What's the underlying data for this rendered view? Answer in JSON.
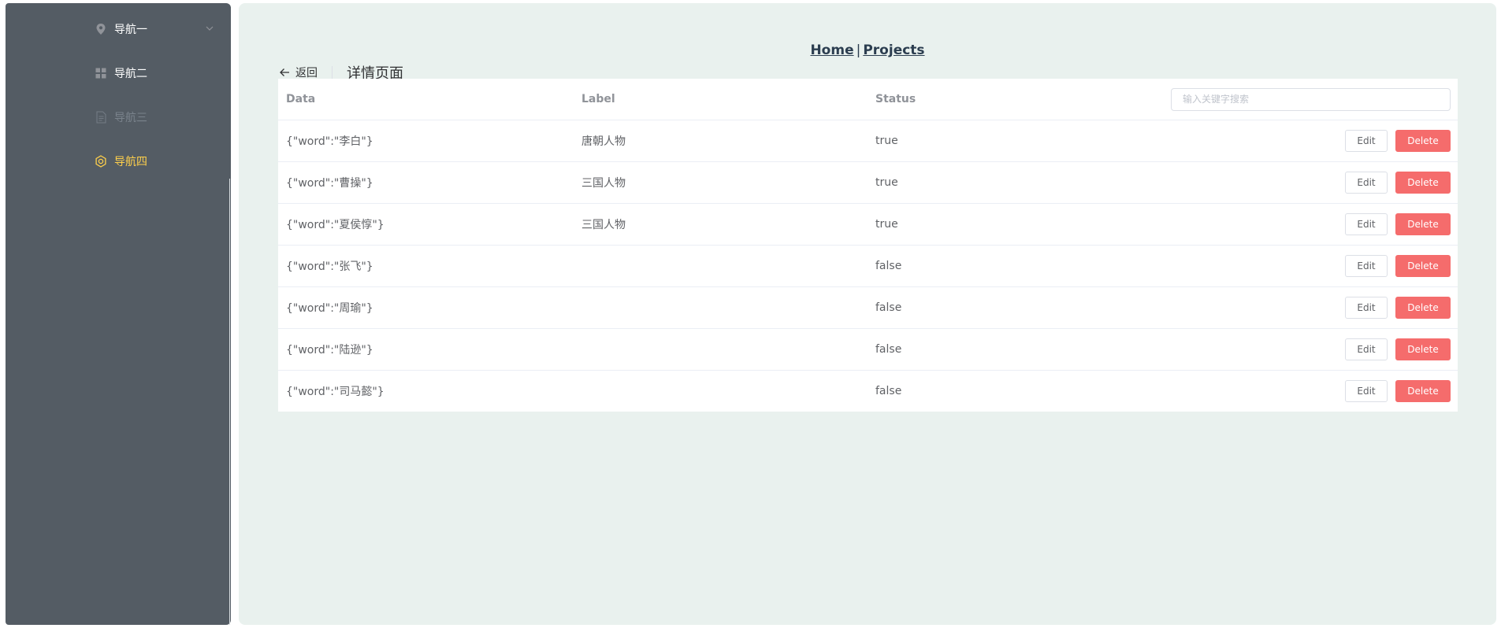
{
  "sidebar": {
    "items": [
      {
        "label": "导航一",
        "icon": "location-icon",
        "state": "normal",
        "has_submenu": true
      },
      {
        "label": "导航二",
        "icon": "menu-grid-icon",
        "state": "normal"
      },
      {
        "label": "导航三",
        "icon": "document-icon",
        "state": "disabled"
      },
      {
        "label": "导航四",
        "icon": "setting-icon",
        "state": "active"
      }
    ],
    "background": "#545c64",
    "active_color": "#ffd04b"
  },
  "top_links": {
    "home": "Home",
    "separator": "|",
    "projects": "Projects"
  },
  "page_header": {
    "back_label": "返回",
    "title": "详情页面"
  },
  "table": {
    "headers": {
      "data": "Data",
      "label": "Label",
      "status": "Status"
    },
    "search_placeholder": "输入关键字搜索",
    "search_value": "",
    "edit_label": "Edit",
    "delete_label": "Delete",
    "rows": [
      {
        "data": "{\"word\":\"李白\"}",
        "label": "唐朝人物",
        "status": "true"
      },
      {
        "data": "{\"word\":\"曹操\"}",
        "label": "三国人物",
        "status": "true"
      },
      {
        "data": "{\"word\":\"夏侯惇\"}",
        "label": "三国人物",
        "status": "true"
      },
      {
        "data": "{\"word\":\"张飞\"}",
        "label": "",
        "status": "false"
      },
      {
        "data": "{\"word\":\"周瑜\"}",
        "label": "",
        "status": "false"
      },
      {
        "data": "{\"word\":\"陆逊\"}",
        "label": "",
        "status": "false"
      },
      {
        "data": "{\"word\":\"司马懿\"}",
        "label": "",
        "status": "false"
      }
    ]
  },
  "colors": {
    "main_background": "#e9f1ee",
    "delete_button": "#f56c6c",
    "link_text": "#2c3e50"
  }
}
